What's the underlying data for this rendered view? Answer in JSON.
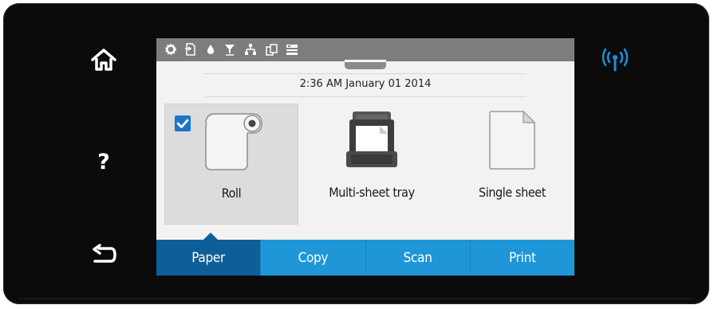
{
  "hardware": {
    "home_icon": "home-icon",
    "help_label": "?",
    "back_icon": "back-arrow-icon",
    "wireless_icon": "wireless-icon",
    "wireless_color": "#1a8fe0"
  },
  "status_bar": {
    "icons": [
      "gear-icon",
      "document-icon",
      "ink-drop-icon",
      "funnel-icon",
      "network-icon",
      "copy-icon",
      "storage-icon"
    ],
    "background": "#7d7d7d"
  },
  "datetime": "2:36 AM January 01 2014",
  "sources": [
    {
      "label": "Roll",
      "icon": "roll-icon",
      "selected": true
    },
    {
      "label": "Multi-sheet tray",
      "icon": "tray-icon",
      "selected": false
    },
    {
      "label": "Single sheet",
      "icon": "sheet-icon",
      "selected": false
    }
  ],
  "tabs": [
    {
      "label": "Paper",
      "active": true
    },
    {
      "label": "Copy",
      "active": false
    },
    {
      "label": "Scan",
      "active": false
    },
    {
      "label": "Print",
      "active": false
    }
  ],
  "colors": {
    "tab": "#1e96d8",
    "tab_active": "#0e5f97",
    "check": "#1a76c8"
  }
}
